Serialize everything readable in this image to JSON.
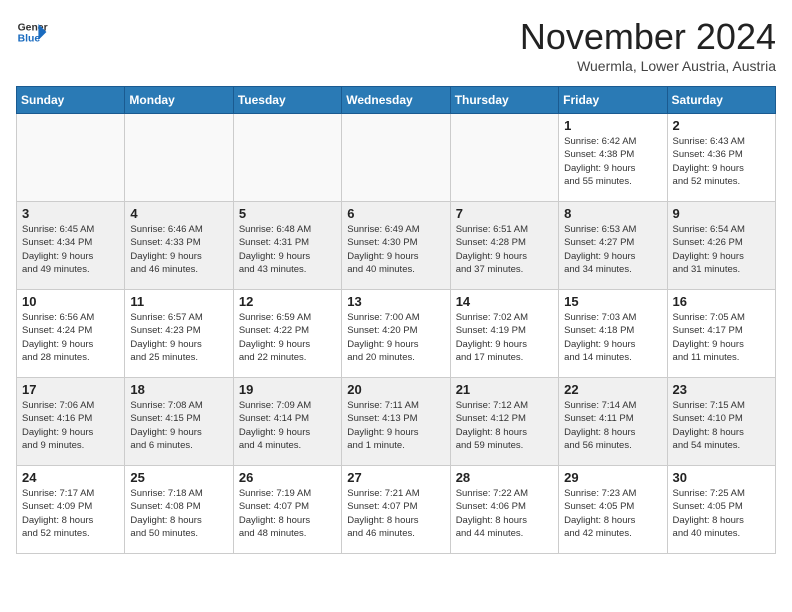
{
  "header": {
    "logo_line1": "General",
    "logo_line2": "Blue",
    "month": "November 2024",
    "location": "Wuermla, Lower Austria, Austria"
  },
  "weekdays": [
    "Sunday",
    "Monday",
    "Tuesday",
    "Wednesday",
    "Thursday",
    "Friday",
    "Saturday"
  ],
  "weeks": [
    [
      {
        "day": "",
        "info": ""
      },
      {
        "day": "",
        "info": ""
      },
      {
        "day": "",
        "info": ""
      },
      {
        "day": "",
        "info": ""
      },
      {
        "day": "",
        "info": ""
      },
      {
        "day": "1",
        "info": "Sunrise: 6:42 AM\nSunset: 4:38 PM\nDaylight: 9 hours\nand 55 minutes."
      },
      {
        "day": "2",
        "info": "Sunrise: 6:43 AM\nSunset: 4:36 PM\nDaylight: 9 hours\nand 52 minutes."
      }
    ],
    [
      {
        "day": "3",
        "info": "Sunrise: 6:45 AM\nSunset: 4:34 PM\nDaylight: 9 hours\nand 49 minutes."
      },
      {
        "day": "4",
        "info": "Sunrise: 6:46 AM\nSunset: 4:33 PM\nDaylight: 9 hours\nand 46 minutes."
      },
      {
        "day": "5",
        "info": "Sunrise: 6:48 AM\nSunset: 4:31 PM\nDaylight: 9 hours\nand 43 minutes."
      },
      {
        "day": "6",
        "info": "Sunrise: 6:49 AM\nSunset: 4:30 PM\nDaylight: 9 hours\nand 40 minutes."
      },
      {
        "day": "7",
        "info": "Sunrise: 6:51 AM\nSunset: 4:28 PM\nDaylight: 9 hours\nand 37 minutes."
      },
      {
        "day": "8",
        "info": "Sunrise: 6:53 AM\nSunset: 4:27 PM\nDaylight: 9 hours\nand 34 minutes."
      },
      {
        "day": "9",
        "info": "Sunrise: 6:54 AM\nSunset: 4:26 PM\nDaylight: 9 hours\nand 31 minutes."
      }
    ],
    [
      {
        "day": "10",
        "info": "Sunrise: 6:56 AM\nSunset: 4:24 PM\nDaylight: 9 hours\nand 28 minutes."
      },
      {
        "day": "11",
        "info": "Sunrise: 6:57 AM\nSunset: 4:23 PM\nDaylight: 9 hours\nand 25 minutes."
      },
      {
        "day": "12",
        "info": "Sunrise: 6:59 AM\nSunset: 4:22 PM\nDaylight: 9 hours\nand 22 minutes."
      },
      {
        "day": "13",
        "info": "Sunrise: 7:00 AM\nSunset: 4:20 PM\nDaylight: 9 hours\nand 20 minutes."
      },
      {
        "day": "14",
        "info": "Sunrise: 7:02 AM\nSunset: 4:19 PM\nDaylight: 9 hours\nand 17 minutes."
      },
      {
        "day": "15",
        "info": "Sunrise: 7:03 AM\nSunset: 4:18 PM\nDaylight: 9 hours\nand 14 minutes."
      },
      {
        "day": "16",
        "info": "Sunrise: 7:05 AM\nSunset: 4:17 PM\nDaylight: 9 hours\nand 11 minutes."
      }
    ],
    [
      {
        "day": "17",
        "info": "Sunrise: 7:06 AM\nSunset: 4:16 PM\nDaylight: 9 hours\nand 9 minutes."
      },
      {
        "day": "18",
        "info": "Sunrise: 7:08 AM\nSunset: 4:15 PM\nDaylight: 9 hours\nand 6 minutes."
      },
      {
        "day": "19",
        "info": "Sunrise: 7:09 AM\nSunset: 4:14 PM\nDaylight: 9 hours\nand 4 minutes."
      },
      {
        "day": "20",
        "info": "Sunrise: 7:11 AM\nSunset: 4:13 PM\nDaylight: 9 hours\nand 1 minute."
      },
      {
        "day": "21",
        "info": "Sunrise: 7:12 AM\nSunset: 4:12 PM\nDaylight: 8 hours\nand 59 minutes."
      },
      {
        "day": "22",
        "info": "Sunrise: 7:14 AM\nSunset: 4:11 PM\nDaylight: 8 hours\nand 56 minutes."
      },
      {
        "day": "23",
        "info": "Sunrise: 7:15 AM\nSunset: 4:10 PM\nDaylight: 8 hours\nand 54 minutes."
      }
    ],
    [
      {
        "day": "24",
        "info": "Sunrise: 7:17 AM\nSunset: 4:09 PM\nDaylight: 8 hours\nand 52 minutes."
      },
      {
        "day": "25",
        "info": "Sunrise: 7:18 AM\nSunset: 4:08 PM\nDaylight: 8 hours\nand 50 minutes."
      },
      {
        "day": "26",
        "info": "Sunrise: 7:19 AM\nSunset: 4:07 PM\nDaylight: 8 hours\nand 48 minutes."
      },
      {
        "day": "27",
        "info": "Sunrise: 7:21 AM\nSunset: 4:07 PM\nDaylight: 8 hours\nand 46 minutes."
      },
      {
        "day": "28",
        "info": "Sunrise: 7:22 AM\nSunset: 4:06 PM\nDaylight: 8 hours\nand 44 minutes."
      },
      {
        "day": "29",
        "info": "Sunrise: 7:23 AM\nSunset: 4:05 PM\nDaylight: 8 hours\nand 42 minutes."
      },
      {
        "day": "30",
        "info": "Sunrise: 7:25 AM\nSunset: 4:05 PM\nDaylight: 8 hours\nand 40 minutes."
      }
    ]
  ]
}
